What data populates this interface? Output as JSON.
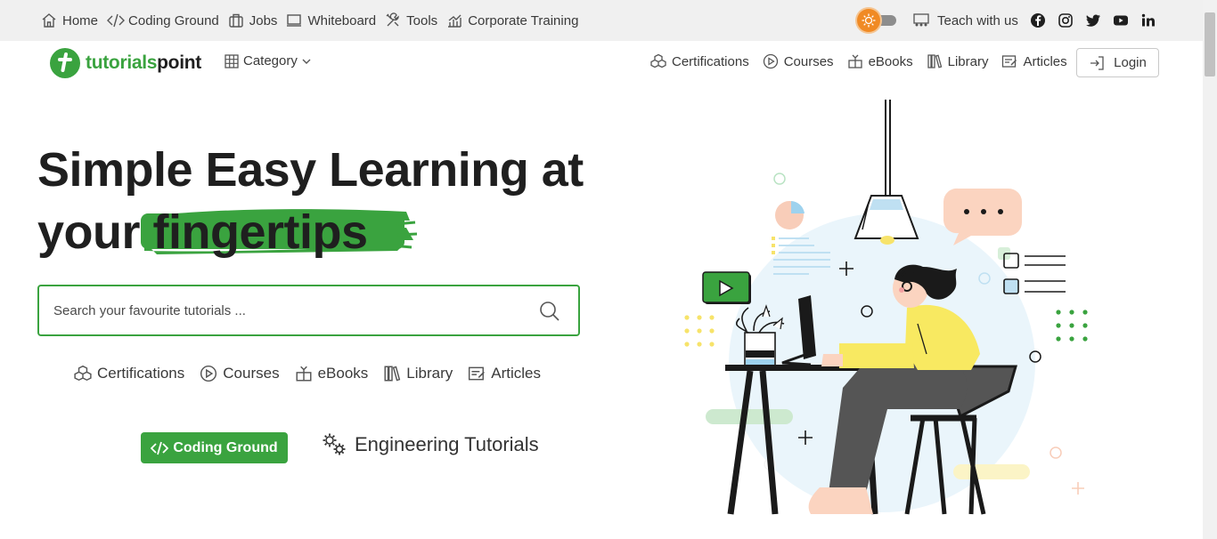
{
  "topbar": {
    "links": [
      {
        "label": "Home",
        "icon": "home-icon"
      },
      {
        "label": "Coding Ground",
        "icon": "code-icon"
      },
      {
        "label": "Jobs",
        "icon": "briefcase-icon"
      },
      {
        "label": "Whiteboard",
        "icon": "whiteboard-icon"
      },
      {
        "label": "Tools",
        "icon": "tools-icon"
      },
      {
        "label": "Corporate Training",
        "icon": "chart-icon"
      }
    ],
    "teach_label": "Teach with us",
    "social": [
      "facebook-icon",
      "instagram-icon",
      "twitter-icon",
      "youtube-icon",
      "linkedin-icon"
    ]
  },
  "brand": {
    "name_part1": "tutorials",
    "name_part2": "point"
  },
  "nav": {
    "category_label": "Category",
    "links": [
      {
        "label": "Certifications",
        "icon": "certifications-icon"
      },
      {
        "label": "Courses",
        "icon": "play-circle-icon"
      },
      {
        "label": "eBooks",
        "icon": "ebooks-icon"
      },
      {
        "label": "Library",
        "icon": "library-icon"
      },
      {
        "label": "Articles",
        "icon": "articles-icon"
      }
    ],
    "login_label": "Login"
  },
  "hero": {
    "title_line1": "Simple Easy Learning at",
    "title_line2_prefix": "your",
    "title_highlight": "fingertips",
    "search_placeholder": "Search your favourite tutorials ...",
    "search_value": "",
    "quick_links": [
      {
        "label": "Certifications",
        "icon": "certifications-icon"
      },
      {
        "label": "Courses",
        "icon": "play-circle-icon"
      },
      {
        "label": "eBooks",
        "icon": "ebooks-icon"
      },
      {
        "label": "Library",
        "icon": "library-icon"
      },
      {
        "label": "Articles",
        "icon": "articles-icon"
      }
    ],
    "coding_ground_label": "Coding Ground",
    "engineering_label": "Engineering Tutorials"
  },
  "colors": {
    "brand_green": "#3aa33f",
    "text_dark": "#1f1f1f",
    "topbar_bg": "#f0f0f0",
    "theme_orange": "#f08a24"
  }
}
